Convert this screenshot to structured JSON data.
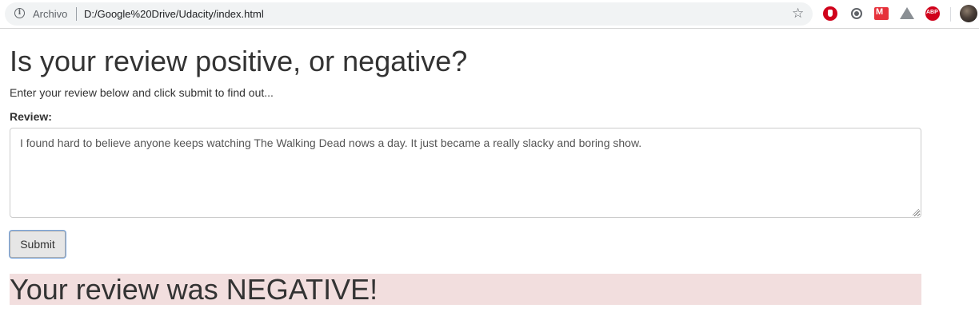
{
  "browser": {
    "security_label": "Archivo",
    "url": "D:/Google%20Drive/Udacity/index.html",
    "icons": [
      "info-icon",
      "star-icon",
      "hand-stop-extension-icon",
      "circle-extension-icon",
      "m-extension-icon",
      "drive-extension-icon",
      "adblock-plus-icon",
      "profile-avatar"
    ],
    "m_ext_label": "M",
    "abp_label": "ABP"
  },
  "page": {
    "title": "Is your review positive, or negative?",
    "subtitle": "Enter your review below and click submit to find out...",
    "review_label": "Review:",
    "review_text": "I found hard to believe anyone keeps watching The Walking Dead nows a day. It just became a really slacky and boring show.",
    "submit_label": "Submit",
    "result_text": "Your review was NEGATIVE!",
    "result_bg_color": "#f2dede"
  }
}
